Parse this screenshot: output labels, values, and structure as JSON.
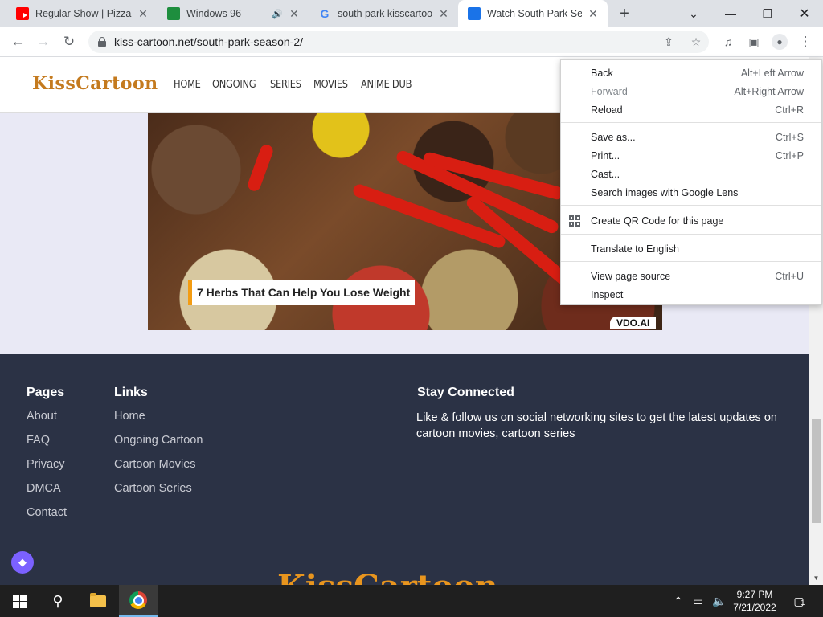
{
  "tabs": [
    {
      "title": "Regular Show | Pizza Po",
      "icon": "youtube-icon",
      "active": false
    },
    {
      "title": "Windows 96",
      "icon": "sheet-icon",
      "active": false,
      "audio": true
    },
    {
      "title": "south park kisscartoon",
      "icon": "google-icon",
      "active": false
    },
    {
      "title": "Watch South Park Sea",
      "icon": "southpark-icon",
      "active": true
    }
  ],
  "toolbar": {
    "url": "kiss-cartoon.net/south-park-season-2/"
  },
  "site": {
    "logo": "KissCartoon",
    "nav": [
      "HOME",
      "ONGOING",
      "SERIES",
      "MOVIES",
      "ANIME DUB"
    ]
  },
  "ad": {
    "caption": "7 Herbs That Can Help You Lose Weight",
    "badge": "VDO.AI"
  },
  "footer": {
    "pages_title": "Pages",
    "pages": [
      "About",
      "FAQ",
      "Privacy",
      "DMCA",
      "Contact"
    ],
    "links_title": "Links",
    "links": [
      "Home",
      "Ongoing Cartoon",
      "Cartoon Movies",
      "Cartoon Series"
    ],
    "connect_title": "Stay Connected",
    "connect_text": "Like & follow us on social networking sites to get the latest updates on cartoon movies, cartoon series",
    "logo": "KissCartoon"
  },
  "context_menu": {
    "back": {
      "label": "Back",
      "shortcut": "Alt+Left Arrow"
    },
    "forward": {
      "label": "Forward",
      "shortcut": "Alt+Right Arrow"
    },
    "reload": {
      "label": "Reload",
      "shortcut": "Ctrl+R"
    },
    "save_as": {
      "label": "Save as...",
      "shortcut": "Ctrl+S"
    },
    "print": {
      "label": "Print...",
      "shortcut": "Ctrl+P"
    },
    "cast": {
      "label": "Cast..."
    },
    "lens": {
      "label": "Search images with Google Lens"
    },
    "qr": {
      "label": "Create QR Code for this page"
    },
    "translate": {
      "label": "Translate to English"
    },
    "view_source": {
      "label": "View page source",
      "shortcut": "Ctrl+U"
    },
    "inspect": {
      "label": "Inspect"
    }
  },
  "taskbar": {
    "time": "9:27 PM",
    "date": "7/21/2022",
    "notification_count": "1"
  }
}
